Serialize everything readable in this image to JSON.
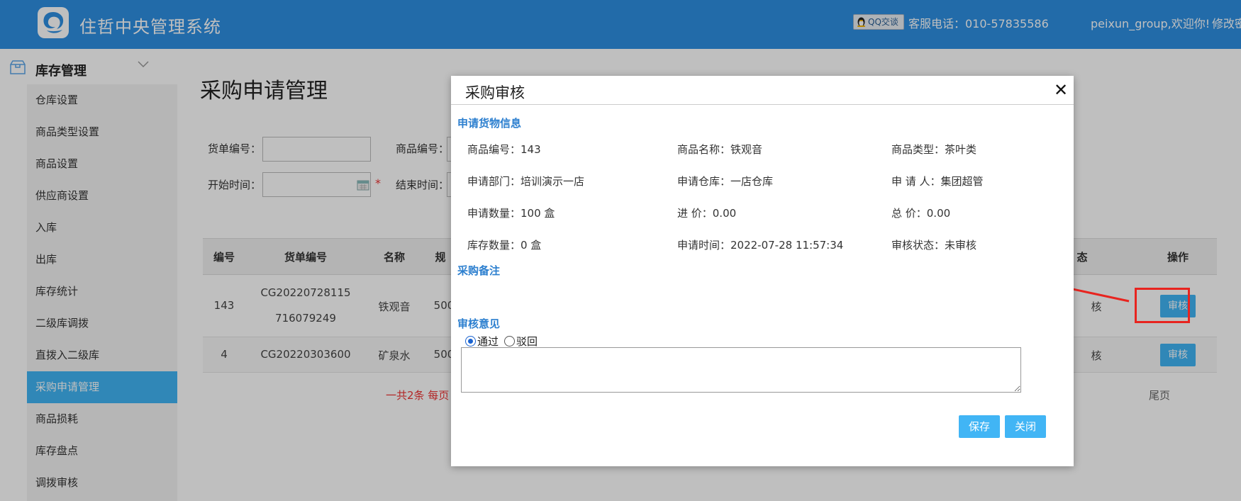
{
  "header": {
    "app_title": "住哲中央管理系统",
    "qq_label": "QQ交谈",
    "hotline": "客服电话：010-57835586",
    "welcome": "peixun_group,欢迎你!",
    "change_password": "修改密",
    "brand_color": "#2e8fe2"
  },
  "sidebar": {
    "title": "库存管理",
    "items": [
      {
        "label": "仓库设置"
      },
      {
        "label": "商品类型设置"
      },
      {
        "label": "商品设置"
      },
      {
        "label": "供应商设置"
      },
      {
        "label": "入库"
      },
      {
        "label": "出库"
      },
      {
        "label": "库存统计"
      },
      {
        "label": "二级库调拨"
      },
      {
        "label": "直拨入二级库"
      },
      {
        "label": "采购申请管理",
        "active": true
      },
      {
        "label": "商品损耗"
      },
      {
        "label": "库存盘点"
      },
      {
        "label": "调拨审核"
      }
    ],
    "active_color": "#41b5f5"
  },
  "main": {
    "page_title": "采购申请管理",
    "filters": {
      "order_no_label": "货单编号：",
      "goods_no_label": "商品编号：",
      "start_time_label": "开始时间：",
      "end_time_label": "结束时间：",
      "required_mark": "*"
    },
    "table": {
      "headers": {
        "id": "编号",
        "order_no": "货单编号",
        "name": "名称",
        "spec": "规",
        "status": "态",
        "action": "操作"
      },
      "rows": [
        {
          "id": "143",
          "order_no_line1": "CG20220728115",
          "order_no_line2": "716079249",
          "name": "铁观音",
          "spec": "500",
          "status": "核",
          "action": "审核"
        },
        {
          "id": "4",
          "order_no": "CG20220303600",
          "name": "矿泉水",
          "spec": "500",
          "status": "核",
          "action": "审核"
        }
      ]
    },
    "pager": {
      "summary": "一共2条  每页",
      "last": "尾页"
    }
  },
  "modal": {
    "title": "采购审核",
    "close": "✕",
    "section_goods": "申请货物信息",
    "fields": {
      "goods_no": "商品编号：143",
      "goods_name": "商品名称：铁观音",
      "goods_type": "商品类型：茶叶类",
      "department": "申请部门：培训演示一店",
      "warehouse": "申请仓库：一店仓库",
      "applicant": "申  请  人：集团超管",
      "quantity": "申请数量：100 盒",
      "price": "进        价：0.00",
      "total": "总        价：0.00",
      "stock": "库存数量：0 盒",
      "apply_time": "申请时间：2022-07-28 11:57:34",
      "audit_status": "审核状态：未审核"
    },
    "section_remark": "采购备注",
    "section_opinion": "审核意见",
    "radio_pass": "通过",
    "radio_reject": "驳回",
    "selected": "通过",
    "opinion_value": "",
    "save": "保存",
    "close_button": "关闭"
  },
  "annotation": {
    "highlight_color": "#e8241f"
  }
}
